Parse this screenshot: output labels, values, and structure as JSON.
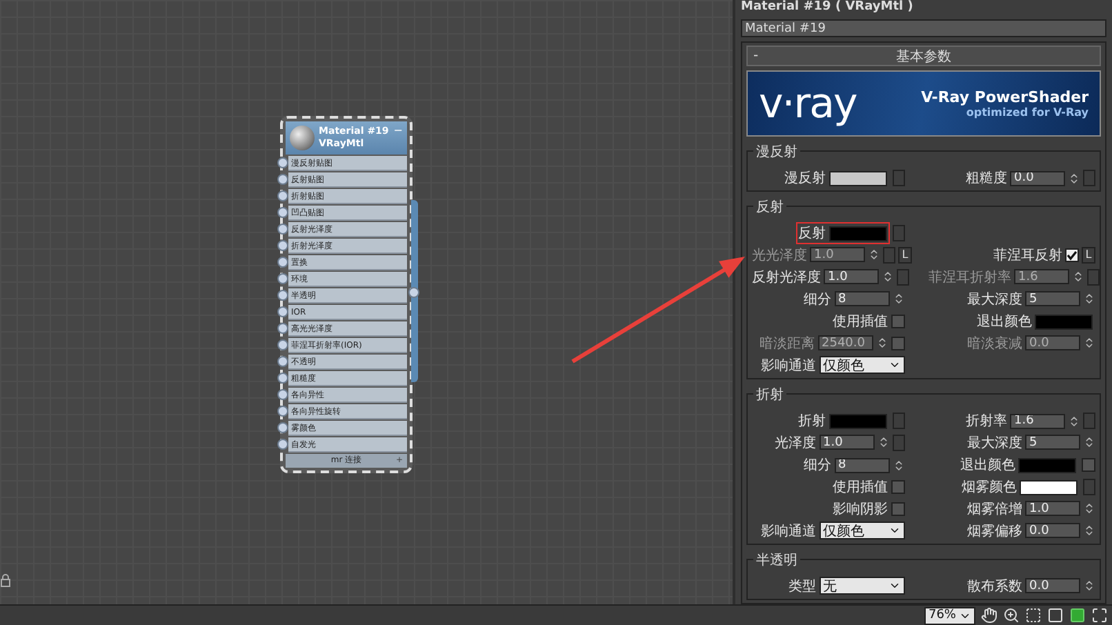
{
  "node": {
    "title": "Material #19",
    "subtitle": "VRayMtl",
    "collapse": "−",
    "slots": [
      "漫反射贴图",
      "反射贴图",
      "折射贴图",
      "凹凸贴图",
      "反射光泽度",
      "折射光泽度",
      "置换",
      "环境",
      "半透明",
      "IOR",
      "高光光泽度",
      "菲涅耳折射率(IOR)",
      "不透明",
      "粗糙度",
      "各向异性",
      "各向异性旋转",
      "雾颜色",
      "自发光"
    ],
    "footer": "mr 连接",
    "footer_mark": "+"
  },
  "panel": {
    "title": "Material #19  ( VRayMtl )",
    "name": "Material #19",
    "rollout": {
      "toggle": "-",
      "title": "基本参数"
    },
    "banner": {
      "logo": "v·ray",
      "title": "V-Ray PowerShader",
      "subtitle": "optimized for V-Ray"
    },
    "groups": [
      {
        "title": "漫反射",
        "rows": [
          {
            "left": {
              "kind": "color",
              "label": "漫反射",
              "color": "#c8c8c8",
              "map_button": true
            },
            "right": {
              "kind": "spinner",
              "label": "粗糙度",
              "value": "0.0",
              "disabled": false,
              "map_button": true
            }
          }
        ]
      },
      {
        "title": "反射",
        "rows": [
          {
            "left": {
              "kind": "color",
              "label": "反射",
              "color": "#000000",
              "map_button": true,
              "highlighted": true
            }
          },
          {
            "left": {
              "kind": "spinner",
              "label": "光光泽度",
              "value": "1.0",
              "disabled": true,
              "map_button": true,
              "lock": "L"
            },
            "right": {
              "kind": "checkbox",
              "label": "菲涅耳反射",
              "checked": true,
              "lock": "L"
            }
          },
          {
            "left": {
              "kind": "spinner",
              "label": "反射光泽度",
              "value": "1.0",
              "disabled": false,
              "map_button": true
            },
            "right": {
              "kind": "spinner",
              "label": "菲涅耳折射率",
              "value": "1.6",
              "disabled": true,
              "map_button": true
            }
          },
          {
            "left": {
              "kind": "spinner",
              "label": "细分",
              "value": "8",
              "disabled": false
            },
            "right": {
              "kind": "spinner",
              "label": "最大深度",
              "value": "5",
              "disabled": false
            }
          },
          {
            "left": {
              "kind": "checkbox",
              "label": "使用插值",
              "checked": false
            },
            "right": {
              "kind": "color",
              "label": "退出颜色",
              "color": "#000000"
            }
          },
          {
            "left": {
              "kind": "spinner",
              "label": "暗淡距离",
              "value": "2540.0",
              "disabled": true,
              "checked": false
            },
            "right": {
              "kind": "spinner",
              "label": "暗淡衰减",
              "value": "0.0",
              "disabled": true
            }
          },
          {
            "left": {
              "kind": "dropdown",
              "label": "影响通道",
              "value": "仅颜色"
            }
          }
        ]
      },
      {
        "title": "折射",
        "rows": [
          {
            "left": {
              "kind": "color",
              "label": "折射",
              "color": "#000000",
              "map_button": true
            },
            "right": {
              "kind": "spinner",
              "label": "折射率",
              "value": "1.6",
              "disabled": false,
              "map_button": true
            }
          },
          {
            "left": {
              "kind": "spinner",
              "label": "光泽度",
              "value": "1.0",
              "disabled": false,
              "map_button": true
            },
            "right": {
              "kind": "spinner",
              "label": "最大深度",
              "value": "5",
              "disabled": false
            }
          },
          {
            "left": {
              "kind": "spinner",
              "label": "细分",
              "value": "8",
              "disabled": false
            },
            "right": {
              "kind": "color",
              "label": "退出颜色",
              "color": "#000000",
              "checked": false
            }
          },
          {
            "left": {
              "kind": "checkbox",
              "label": "使用插值",
              "checked": false
            },
            "right": {
              "kind": "color",
              "label": "烟雾颜色",
              "color": "#ffffff",
              "map_button": true
            }
          },
          {
            "left": {
              "kind": "checkbox",
              "label": "影响阴影",
              "checked": false
            },
            "right": {
              "kind": "spinner",
              "label": "烟雾倍增",
              "value": "1.0",
              "disabled": false
            }
          },
          {
            "left": {
              "kind": "dropdown",
              "label": "影响通道",
              "value": "仅颜色"
            },
            "right": {
              "kind": "spinner",
              "label": "烟雾偏移",
              "value": "0.0",
              "disabled": false
            }
          }
        ]
      },
      {
        "title": "半透明",
        "rows": [
          {
            "left": {
              "kind": "dropdown",
              "label": "类型",
              "value": "无"
            },
            "right": {
              "kind": "spinner",
              "label": "散布系数",
              "value": "0.0",
              "disabled": false
            }
          }
        ]
      }
    ]
  },
  "status_bar": {
    "zoom": "76%"
  }
}
